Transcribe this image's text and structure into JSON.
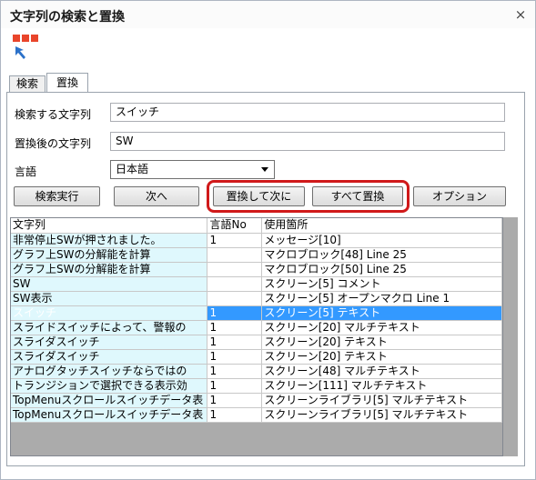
{
  "window": {
    "title": "文字列の検索と置換",
    "close_glyph": "×"
  },
  "toolbar": {
    "icon": "search-replace-tool-icon",
    "colors": {
      "tile": "#e9452b",
      "arrow": "#2b71c9"
    }
  },
  "tabs": [
    {
      "label": "検索",
      "active": false
    },
    {
      "label": "置換",
      "active": true
    }
  ],
  "form": {
    "search_label": "検索する文字列",
    "search_value": "スイッチ",
    "replace_label": "置換後の文字列",
    "replace_value": "SW",
    "language_label": "言語",
    "language_value": "日本語"
  },
  "buttons": {
    "search": "検索実行",
    "next": "次へ",
    "replace_next": "置換して次に",
    "replace_all": "すべて置換",
    "options": "オプション"
  },
  "table": {
    "columns": [
      "文字列",
      "言語No",
      "使用箇所"
    ],
    "rows": [
      {
        "text": "非常停止SWが押されました。",
        "lang": "1",
        "location": "メッセージ[10]",
        "selected": false
      },
      {
        "text": "グラフ上SWの分解能を計算",
        "lang": "",
        "location": "マクロブロック[48] Line 25",
        "selected": false
      },
      {
        "text": "グラフ上SWの分解能を計算",
        "lang": "",
        "location": "マクロブロック[50] Line 25",
        "selected": false
      },
      {
        "text": "SW",
        "lang": "",
        "location": "スクリーン[5] コメント",
        "selected": false
      },
      {
        "text": "SW表示",
        "lang": "",
        "location": "スクリーン[5] オープンマクロ Line 1",
        "selected": false
      },
      {
        "text": "スイッチ",
        "lang": "1",
        "location": "スクリーン[5] テキスト",
        "selected": true
      },
      {
        "text": "スライドスイッチによって、警報の",
        "lang": "1",
        "location": "スクリーン[20] マルチテキスト",
        "selected": false
      },
      {
        "text": "スライダスイッチ",
        "lang": "1",
        "location": "スクリーン[20] テキスト",
        "selected": false
      },
      {
        "text": "スライダスイッチ",
        "lang": "1",
        "location": "スクリーン[20] テキスト",
        "selected": false
      },
      {
        "text": "アナログタッチスイッチならではの",
        "lang": "1",
        "location": "スクリーン[48] マルチテキスト",
        "selected": false
      },
      {
        "text": "トランジションで選択できる表示効",
        "lang": "1",
        "location": "スクリーン[111] マルチテキスト",
        "selected": false
      },
      {
        "text": "TopMenuスクロールスイッチデータ表",
        "lang": "1",
        "location": "スクリーンライブラリ[5] マルチテキスト",
        "selected": false
      },
      {
        "text": "TopMenuスクロールスイッチデータ表",
        "lang": "1",
        "location": "スクリーンライブラリ[5] マルチテキスト",
        "selected": false
      }
    ]
  }
}
